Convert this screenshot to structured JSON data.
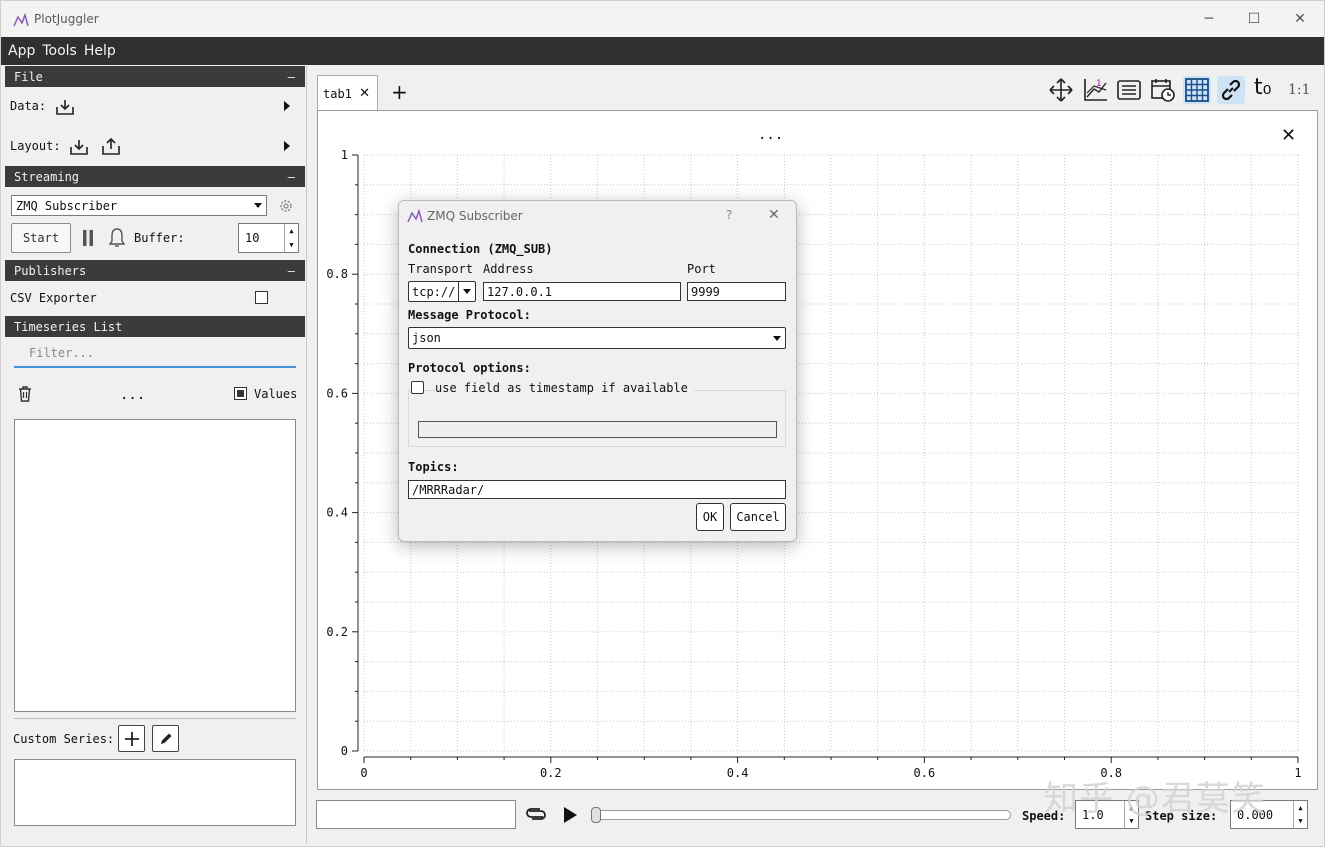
{
  "window": {
    "title": "PlotJuggler",
    "minimize": "─",
    "maximize": "☐",
    "close": "✕"
  },
  "menu": [
    "App",
    "Tools",
    "Help"
  ],
  "sidebar": {
    "file_header": "File",
    "data_label": "Data:",
    "layout_label": "Layout:",
    "streaming_header": "Streaming",
    "streaming_source": "ZMQ Subscriber",
    "start_button": "Start",
    "buffer_label": "Buffer:",
    "buffer_value": "10",
    "publishers_header": "Publishers",
    "csv_exporter": "CSV Exporter",
    "timeseries_header": "Timeseries List",
    "filter_placeholder": "Filter...",
    "more_dots": "...",
    "values_label": "Values",
    "custom_series_label": "Custom Series:",
    "collapse_symbol": "–"
  },
  "tabs": {
    "tab1": "tab1",
    "add": "+",
    "close": "✕"
  },
  "toolbar": {
    "t0_label": "t₀",
    "ratio_label": "1:1"
  },
  "plot": {
    "title_dots": "...",
    "close": "✕"
  },
  "chart_data": {
    "type": "line",
    "xlim": [
      0,
      1
    ],
    "ylim": [
      0,
      1
    ],
    "x_ticks": [
      "0",
      "0.2",
      "0.4",
      "0.6",
      "0.8",
      "1"
    ],
    "y_ticks": [
      "0",
      "0.2",
      "0.4",
      "0.6",
      "0.8",
      "1"
    ],
    "grid": true,
    "series": []
  },
  "playback": {
    "speed_label": "Speed:",
    "speed_value": "1.0",
    "step_label": "Step size:",
    "step_value": "0.000"
  },
  "dialog": {
    "title": "ZMQ Subscriber",
    "help": "?",
    "close": "✕",
    "connection_header": "Connection (ZMQ_SUB)",
    "transport_label": "Transport",
    "address_label": "Address",
    "port_label": "Port",
    "transport_value": "tcp://",
    "address_value": "127.0.0.1",
    "port_value": "9999",
    "protocol_header": "Message Protocol:",
    "protocol_value": "json",
    "options_header": "Protocol options:",
    "timestamp_option": "use field as timestamp if available",
    "topics_header": "Topics:",
    "topics_value": "/MRRRadar/",
    "ok": "OK",
    "cancel": "Cancel"
  },
  "watermark": "知乎 @君莫笑",
  "colors": {
    "menubar": "#2f2f2f",
    "section_header": "#3b3b3b",
    "active_tool": "#cfe3f7",
    "accent_magenta": "#c000c0"
  }
}
